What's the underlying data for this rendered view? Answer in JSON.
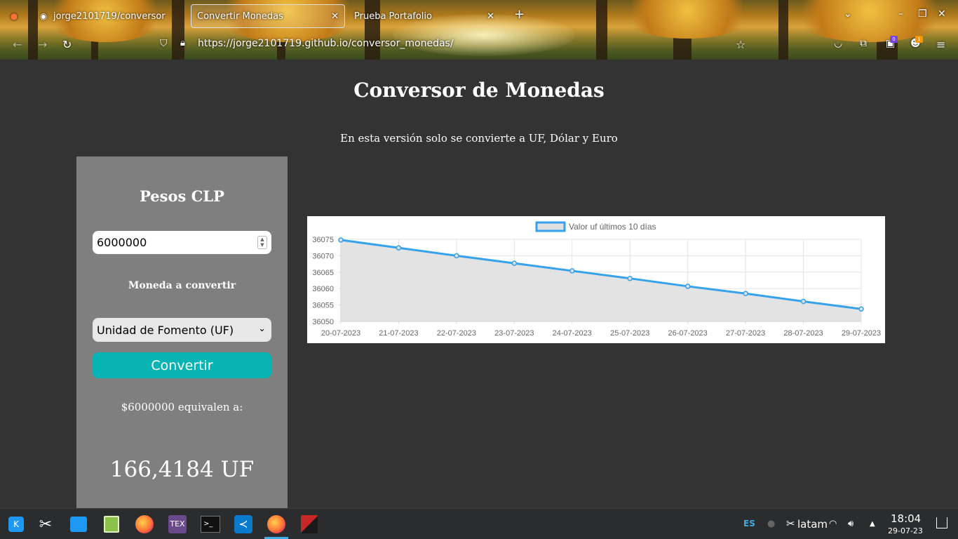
{
  "browser": {
    "tabs": [
      {
        "label": "jorge2101719/conversor",
        "icon": "github-icon"
      },
      {
        "label": "Convertir Monedas",
        "icon": "",
        "active": true
      },
      {
        "label": "Prueba Portafolio",
        "icon": ""
      }
    ],
    "url": "https://jorge2101719.github.io/conversor_monedas/",
    "badges": {
      "extensions_count": "0",
      "account_count": "1"
    }
  },
  "page": {
    "title": "Conversor de Monedas",
    "subtitle": "En esta versión solo se convierte a UF, Dólar y Euro"
  },
  "converter": {
    "heading": "Pesos CLP",
    "amount_value": "6000000",
    "currency_label": "Moneda a convertir",
    "currency_selected": "Unidad de Fomento (UF)",
    "convert_button": "Convertir",
    "equivalence_text": "$6000000 equivalen a:",
    "result": "166,4184 UF"
  },
  "chart_data": {
    "type": "line",
    "legend": "Valor uf últimos 10 días",
    "x": [
      "20-07-2023",
      "21-07-2023",
      "22-07-2023",
      "23-07-2023",
      "24-07-2023",
      "25-07-2023",
      "26-07-2023",
      "27-07-2023",
      "28-07-2023",
      "29-07-2023"
    ],
    "series": [
      {
        "name": "Valor uf últimos 10 días",
        "values": [
          36074.8,
          36072.4,
          36070.0,
          36067.7,
          36065.4,
          36063.1,
          36060.7,
          36058.5,
          36056.1,
          36053.8
        ]
      }
    ],
    "yticks": [
      36050,
      36055,
      36060,
      36065,
      36070,
      36075
    ],
    "ylim": [
      36050,
      36075
    ],
    "grid": true,
    "colors": {
      "line": "#36a2eb",
      "fill": "#e0e0e0"
    }
  },
  "taskbar": {
    "apps": [
      "kde-menu-icon",
      "tools-icon",
      "discover-icon",
      "file-manager-icon",
      "firefox-icon",
      "texmaker-icon",
      "terminal-icon",
      "vscode-icon",
      "firefox-icon",
      "app-icon"
    ],
    "keyboard_layout": "ES",
    "network_label": "latam",
    "time": "18:04",
    "date": "29-07-23"
  },
  "colors": {
    "page_bg": "#333333",
    "panel_bg": "#7f7f7f",
    "button": "#08b3b3",
    "accent": "#3daee9"
  }
}
